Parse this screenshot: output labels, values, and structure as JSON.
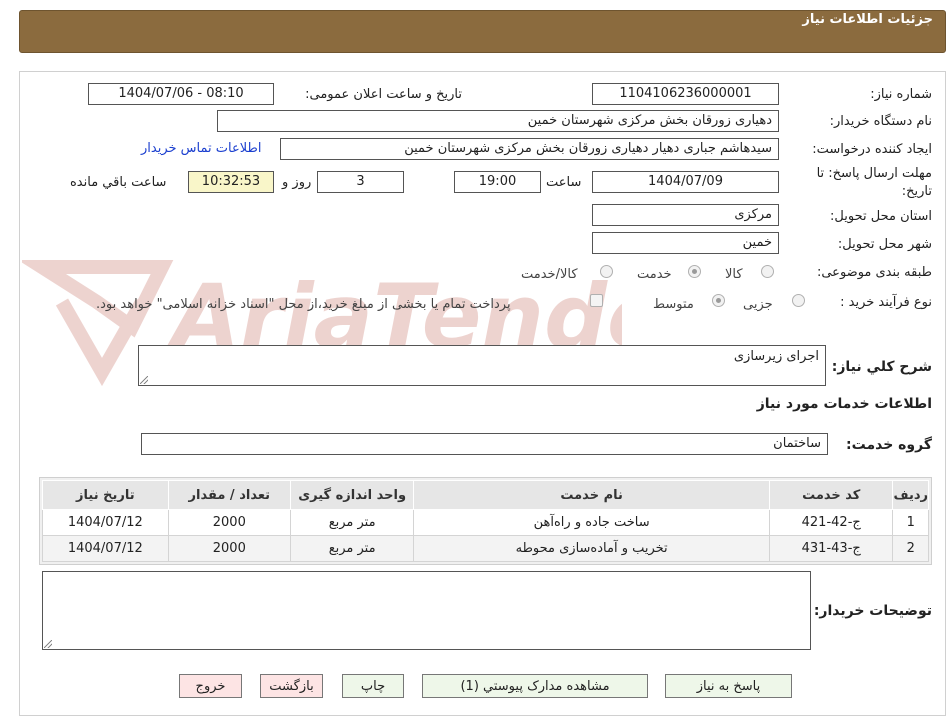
{
  "header": {
    "title": "جزئیات اطلاعات نیاز"
  },
  "form": {
    "need_number_label": "شماره نیاز:",
    "need_number": "1104106236000001",
    "announce_label": "تاریخ و ساعت اعلان عمومی:",
    "announce_value": "1404/07/06 - 08:10",
    "buyer_org_label": "نام دستگاه خریدار:",
    "buyer_org": "دهیاری زورقان  بخش مرکزی شهرستان خمین",
    "creator_label": "ایجاد کننده درخواست:",
    "creator": "سیدهاشم جباری دهیار دهیاری زورقان  بخش مرکزی شهرستان خمین",
    "contact_link": "اطلاعات تماس خریدار",
    "deadline_label": "مهلت ارسال پاسخ: تا تاریخ:",
    "deadline_date": "1404/07/09",
    "time_label": "ساعت",
    "deadline_time": "19:00",
    "days_value": "3",
    "days_label": "روز و",
    "remaining_time": "10:32:53",
    "remaining_label": "ساعت باقي مانده",
    "province_label": "استان محل تحویل:",
    "province": "مرکزی",
    "city_label": "شهر محل تحویل:",
    "city": "خمین",
    "category_label": "طبقه بندی موضوعی:",
    "category_options": [
      "کالا",
      "خدمت",
      "کالا/خدمت"
    ],
    "process_label": "نوع فرآیند خرید :",
    "process_options": [
      "جزیی",
      "متوسط"
    ],
    "payment_note": "پرداخت تمام یا بخشی از مبلغ خرید،از محل \"اسناد خزانه اسلامی\" خواهد بود."
  },
  "summary": {
    "label": "شرح كلي نياز:",
    "value": "اجرای زیرسازی"
  },
  "services": {
    "title": "اطلاعات خدمات مورد نياز",
    "group_label": "گروه خدمت:",
    "group_value": "ساختمان",
    "columns": [
      "ردیف",
      "کد خدمت",
      "نام خدمت",
      "واحد اندازه گیری",
      "تعداد / مقدار",
      "تاریخ نیاز"
    ],
    "rows": [
      [
        "1",
        "ج-42-421",
        "ساخت جاده و راه‌آهن",
        "متر مربع",
        "2000",
        "1404/07/12"
      ],
      [
        "2",
        "ج-43-431",
        "تخریب و آماده‌سازی محوطه",
        "متر مربع",
        "2000",
        "1404/07/12"
      ]
    ]
  },
  "buyer_notes": {
    "label": "توضیحات خریدار:",
    "value": ""
  },
  "buttons": {
    "reply": "پاسخ به نیاز",
    "attachments": "مشاهده مدارک پیوستي (1)",
    "print": "چاپ",
    "back": "بازگشت",
    "exit": "خروج"
  },
  "watermark": {
    "text": "AriaTender.neT"
  },
  "colors": {
    "header": "#8b6b3e",
    "link": "#1b3fcf",
    "remaining_bg": "#f9f6c9"
  }
}
